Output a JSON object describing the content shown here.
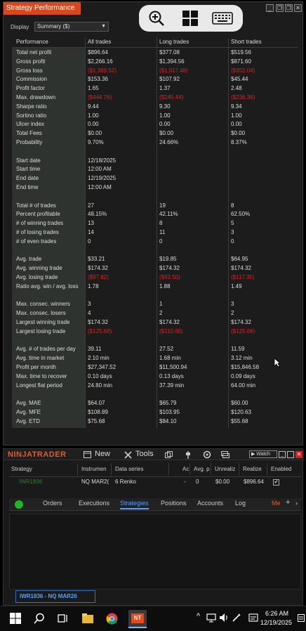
{
  "perf_window": {
    "title": "Strategy Performance",
    "display_label": "Display",
    "display_value": "Summary ($)",
    "win_buttons": [
      "_",
      "❐",
      "❐",
      "✕"
    ]
  },
  "table": {
    "headers": [
      "Performance",
      "All trades",
      "Long trades",
      "Short trades"
    ],
    "rows": [
      {
        "label": "Total net profit",
        "all": "$896.64",
        "long": "$377.08",
        "short": "$519.56",
        "neg": [
          false,
          false,
          false
        ]
      },
      {
        "label": "Gross profit",
        "all": "$2,266.16",
        "long": "$1,394.56",
        "short": "$871.60",
        "neg": [
          false,
          false,
          false
        ]
      },
      {
        "label": "Gross loss",
        "all": "($1,369.52)",
        "long": "($1,017.48)",
        "short": "($352.04)",
        "neg": [
          true,
          true,
          true
        ]
      },
      {
        "label": "Commission",
        "all": "$153.36",
        "long": "$107.92",
        "short": "$45.44",
        "neg": [
          false,
          false,
          false
        ]
      },
      {
        "label": "Profit factor",
        "all": "1.65",
        "long": "1.37",
        "short": "2.48",
        "neg": [
          false,
          false,
          false
        ]
      },
      {
        "label": "Max. drawdown",
        "all": "($444.76)",
        "long": "($245.44)",
        "short": "($236.36)",
        "neg": [
          true,
          true,
          true
        ]
      },
      {
        "label": "Sharpe ratio",
        "all": "9.44",
        "long": "9.30",
        "short": "9.34",
        "neg": [
          false,
          false,
          false
        ]
      },
      {
        "label": "Sortino ratio",
        "all": "1.00",
        "long": "1.00",
        "short": "1.00",
        "neg": [
          false,
          false,
          false
        ]
      },
      {
        "label": "Ulcer index",
        "all": "0.00",
        "long": "0.00",
        "short": "0.00",
        "neg": [
          false,
          false,
          false
        ]
      },
      {
        "label": "Total Fees",
        "all": "$0.00",
        "long": "$0.00",
        "short": "$0.00",
        "neg": [
          false,
          false,
          false
        ]
      },
      {
        "label": "Probability",
        "all": "9.70%",
        "long": "24.66%",
        "short": "8.37%",
        "neg": [
          false,
          false,
          false
        ]
      },
      {
        "label": "",
        "all": "",
        "long": "",
        "short": "",
        "neg": [
          false,
          false,
          false
        ]
      },
      {
        "label": "Start date",
        "all": "12/18/2025",
        "long": "",
        "short": "",
        "neg": [
          false,
          false,
          false
        ]
      },
      {
        "label": "Start time",
        "all": "12:00 AM",
        "long": "",
        "short": "",
        "neg": [
          false,
          false,
          false
        ]
      },
      {
        "label": "End date",
        "all": "12/19/2025",
        "long": "",
        "short": "",
        "neg": [
          false,
          false,
          false
        ]
      },
      {
        "label": "End time",
        "all": "12:00 AM",
        "long": "",
        "short": "",
        "neg": [
          false,
          false,
          false
        ]
      },
      {
        "label": "",
        "all": "",
        "long": "",
        "short": "",
        "neg": [
          false,
          false,
          false
        ]
      },
      {
        "label": "Total # of trades",
        "all": "27",
        "long": "19",
        "short": "8",
        "neg": [
          false,
          false,
          false
        ]
      },
      {
        "label": "Percent profitable",
        "all": "48.15%",
        "long": "42.11%",
        "short": "62.50%",
        "neg": [
          false,
          false,
          false
        ]
      },
      {
        "label": "# of winning trades",
        "all": "13",
        "long": "8",
        "short": "5",
        "neg": [
          false,
          false,
          false
        ]
      },
      {
        "label": "# of losing trades",
        "all": "14",
        "long": "11",
        "short": "3",
        "neg": [
          false,
          false,
          false
        ]
      },
      {
        "label": "# of even trades",
        "all": "0",
        "long": "0",
        "short": "0",
        "neg": [
          false,
          false,
          false
        ]
      },
      {
        "label": "",
        "all": "",
        "long": "",
        "short": "",
        "neg": [
          false,
          false,
          false
        ]
      },
      {
        "label": "Avg. trade",
        "all": "$33.21",
        "long": "$19.85",
        "short": "$64.95",
        "neg": [
          false,
          false,
          false
        ]
      },
      {
        "label": "Avg. winning trade",
        "all": "$174.32",
        "long": "$174.32",
        "short": "$174.32",
        "neg": [
          false,
          false,
          false
        ]
      },
      {
        "label": "Avg. losing trade",
        "all": "($97.82)",
        "long": "($92.50)",
        "short": "($117.35)",
        "neg": [
          true,
          true,
          true
        ]
      },
      {
        "label": "Ratio avg. win / avg. loss",
        "all": "1.78",
        "long": "1.88",
        "short": "1.49",
        "neg": [
          false,
          false,
          false
        ]
      },
      {
        "label": "",
        "all": "",
        "long": "",
        "short": "",
        "neg": [
          false,
          false,
          false
        ]
      },
      {
        "label": "Max. consec. winners",
        "all": "3",
        "long": "1",
        "short": "3",
        "neg": [
          false,
          false,
          false
        ]
      },
      {
        "label": "Max. consec. losers",
        "all": "4",
        "long": "2",
        "short": "2",
        "neg": [
          false,
          false,
          false
        ]
      },
      {
        "label": "Largest winning trade",
        "all": "$174.32",
        "long": "$174.32",
        "short": "$174.32",
        "neg": [
          false,
          false,
          false
        ]
      },
      {
        "label": "Largest losing trade",
        "all": "($125.68)",
        "long": "($110.60)",
        "short": "($125.68)",
        "neg": [
          true,
          true,
          true
        ]
      },
      {
        "label": "",
        "all": "",
        "long": "",
        "short": "",
        "neg": [
          false,
          false,
          false
        ]
      },
      {
        "label": "Avg. # of trades per day",
        "all": "39.11",
        "long": "27.52",
        "short": "11.59",
        "neg": [
          false,
          false,
          false
        ]
      },
      {
        "label": "Avg. time in market",
        "all": "2.10 min",
        "long": "1.68 min",
        "short": "3.12 min",
        "neg": [
          false,
          false,
          false
        ]
      },
      {
        "label": "Profit per month",
        "all": "$27,347.52",
        "long": "$11,500.94",
        "short": "$15,846.58",
        "neg": [
          false,
          false,
          false
        ]
      },
      {
        "label": "Max. time to recover",
        "all": "0.10 days",
        "long": "0.13 days",
        "short": "0.09 days",
        "neg": [
          false,
          false,
          false
        ]
      },
      {
        "label": "Longest flat period",
        "all": "24.80 min",
        "long": "37.39 min",
        "short": "64.00 min",
        "neg": [
          false,
          false,
          false
        ]
      },
      {
        "label": "",
        "all": "",
        "long": "",
        "short": "",
        "neg": [
          false,
          false,
          false
        ]
      },
      {
        "label": "Avg. MAE",
        "all": "$64.07",
        "long": "$65.79",
        "short": "$60.00",
        "neg": [
          false,
          false,
          false
        ]
      },
      {
        "label": "Avg. MFE",
        "all": "$108.89",
        "long": "$103.95",
        "short": "$120.63",
        "neg": [
          false,
          false,
          false
        ]
      },
      {
        "label": "Avg. ETD",
        "all": "$75.68",
        "long": "$84.10",
        "short": "$55.68",
        "neg": [
          false,
          false,
          false
        ]
      }
    ]
  },
  "nt": {
    "logo": "NINJATRADER",
    "menu_new": "New",
    "menu_tools": "Tools",
    "watch": "Watch",
    "grid_headers": [
      "Strategy",
      "Instrumen",
      "Data series",
      "Ac",
      "Avg. p",
      "Unrealiz",
      "Realize",
      "Enabled"
    ],
    "grid_row": [
      "IWR1836",
      "NQ MAR2(",
      "6 Renko",
      "-",
      "0",
      "$0.00",
      "$896.64",
      "✔"
    ],
    "tabs": [
      "Orders",
      "Executions",
      "Strategies",
      "Positions",
      "Accounts",
      "Log",
      "Me"
    ],
    "active_tab": "Strategies",
    "chart_tab": "IWR1836 - NQ MAR26"
  },
  "taskbar": {
    "time": "6:26 AM",
    "date": "12/19/2025"
  },
  "colors": {
    "title_orange": "#d9481c",
    "negative_red": "#e02020",
    "active_tab_blue": "#4fa3ff",
    "logo_orange": "#e85a24"
  }
}
